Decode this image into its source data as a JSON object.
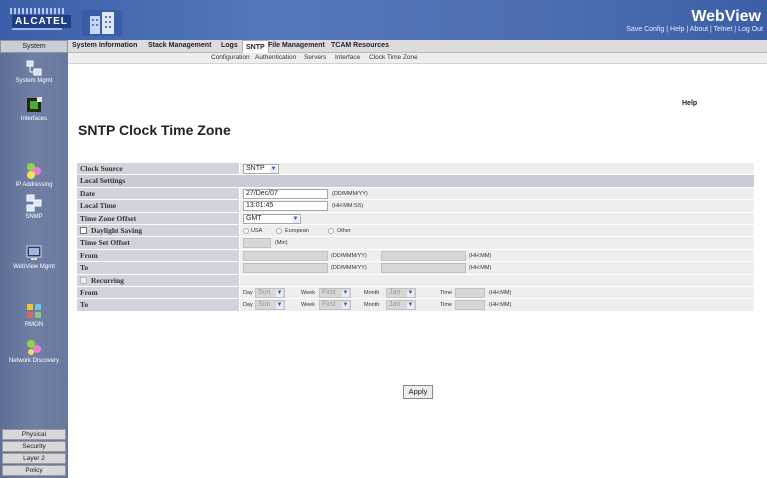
{
  "header": {
    "brand": "ALCATEL",
    "title": "WebView",
    "links": [
      "Save Config",
      "Help",
      "About",
      "Telnet",
      "Log Out"
    ]
  },
  "sidebar": {
    "system": "System",
    "items": [
      {
        "label": "System Mgmt",
        "icon": "system-mgmt-icon"
      },
      {
        "label": "Interfaces",
        "icon": "interfaces-icon"
      },
      {
        "label": "IP Addressing",
        "icon": "ip-addressing-icon"
      },
      {
        "label": "SNMP",
        "icon": "snmp-icon"
      },
      {
        "label": "WebView Mgmt",
        "icon": "webview-mgmt-icon"
      },
      {
        "label": "RMON",
        "icon": "rmon-icon"
      },
      {
        "label": "Network Discovery",
        "icon": "network-discovery-icon"
      }
    ],
    "bottom": [
      "Physical",
      "Security",
      "Layer 2",
      "Policy"
    ]
  },
  "topnav": {
    "tabs": [
      "System Information",
      "Stack Management",
      "Logs",
      "SNTP",
      "File Management",
      "TCAM Resources"
    ],
    "active": "SNTP"
  },
  "subnav": [
    "Configuration",
    "Authentication",
    "Servers",
    "Interface",
    "Clock Time Zone"
  ],
  "help": "Help",
  "page_title": "SNTP Clock Time Zone",
  "form": {
    "clock_source_label": "Clock Source",
    "clock_source_value": "SNTP",
    "local_settings_label": "Local Settings",
    "date_label": "Date",
    "date_value": "27/Dec/07",
    "date_format": "(DD/MMM/YY)",
    "local_time_label": "Local Time",
    "local_time_value": "13:01:45",
    "time_format": "(HH:MM:SS)",
    "tz_offset_label": "Time Zone Offset",
    "tz_offset_value": "GMT",
    "daylight_label": "Daylight Saving",
    "daylight_options": [
      "USA",
      "European",
      "Other"
    ],
    "time_set_offset_label": "Time Set Offset",
    "time_set_offset_unit": "(Min)",
    "from_label": "From",
    "to_label": "To",
    "from_date_format": "(DD/MMM/YY)",
    "from_time_format": "(HH:MM)",
    "recurring_label": "Recurring",
    "rec_day_label": "Day",
    "rec_day_value": "Sun",
    "rec_week_label": "Week",
    "rec_week_value": "First",
    "rec_month_label": "Month",
    "rec_month_value": "Jan",
    "rec_time_label": "Time",
    "rec_time_format": "(HH:MM)"
  },
  "apply_label": "Apply",
  "colors": {
    "header": "#4d6fb2",
    "sidebar": "#7080a5",
    "label_bg": "#d1d4dc",
    "value_bg": "#eeeeee"
  }
}
